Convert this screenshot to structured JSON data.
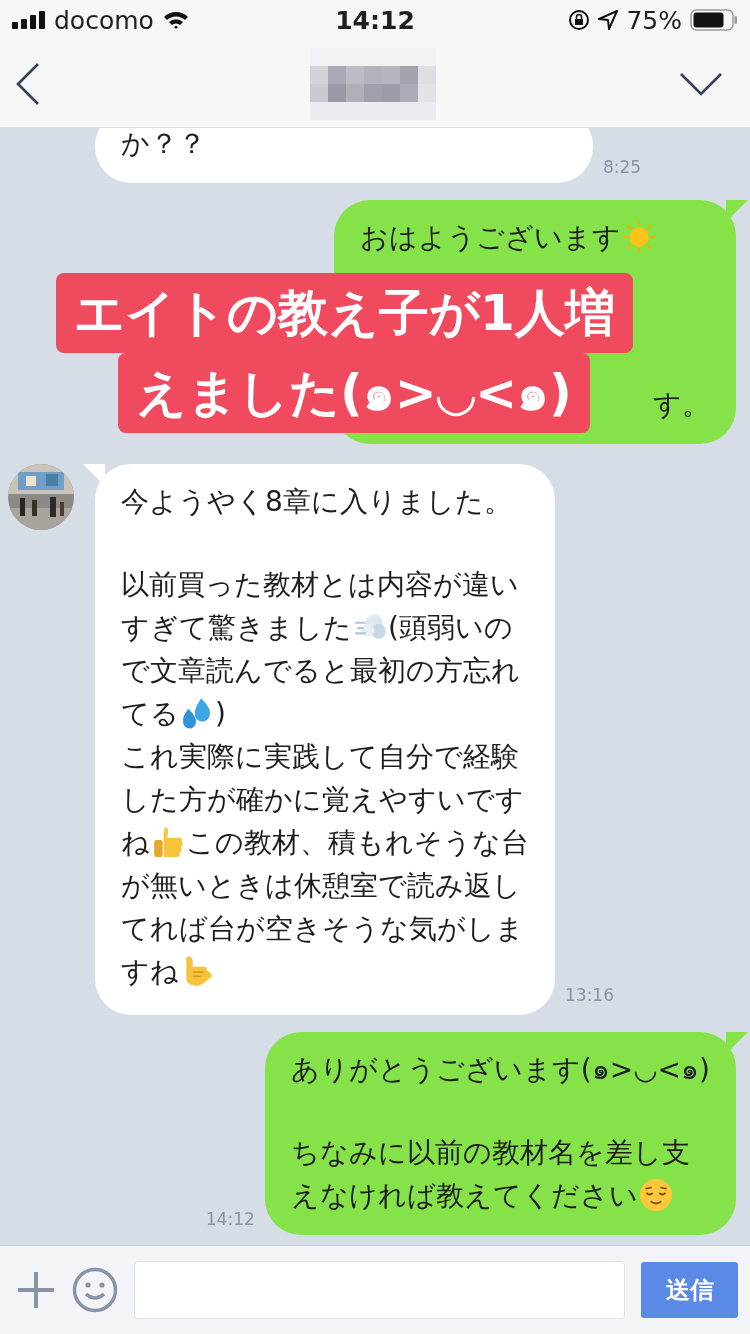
{
  "status_bar": {
    "carrier": "docomo",
    "time": "14:12",
    "battery": "75%"
  },
  "messages": [
    {
      "kind": "received",
      "avatar": false,
      "cut_top": true,
      "time": "8:25",
      "paragraphs": [
        [
          [
            {
              "kind": "text",
              "text": "か？？"
            }
          ]
        ]
      ]
    },
    {
      "kind": "sent",
      "covered": true,
      "paragraphs": [
        [
          [
            {
              "kind": "text",
              "text": "おはようございます"
            },
            {
              "kind": "sun"
            }
          ]
        ],
        [
          [
            {
              "kind": "text",
              "text": "す。"
            }
          ]
        ]
      ]
    },
    {
      "kind": "received",
      "avatar": true,
      "time": "13:16",
      "paragraphs": [
        [
          [
            {
              "kind": "text",
              "text": "今ようやく8章に入りました。"
            }
          ]
        ],
        [
          [
            {
              "kind": "text",
              "text": "以前買った教材とは内容が違い"
            }
          ],
          [
            {
              "kind": "text",
              "text": "すぎて驚きました"
            },
            {
              "kind": "dash"
            },
            {
              "kind": "text",
              "text": "(頭弱いの"
            }
          ],
          [
            {
              "kind": "text",
              "text": "で文章読んでると最初の方忘れ"
            }
          ],
          [
            {
              "kind": "text",
              "text": "てる"
            },
            {
              "kind": "sweat"
            },
            {
              "kind": "text",
              "text": ")"
            }
          ],
          [
            {
              "kind": "text",
              "text": "これ実際に実践して自分で経験"
            }
          ],
          [
            {
              "kind": "text",
              "text": "した方が確かに覚えやすいです"
            }
          ],
          [
            {
              "kind": "text",
              "text": "ね"
            },
            {
              "kind": "thumbs"
            },
            {
              "kind": "text",
              "text": "この教材、積もれそうな台"
            }
          ],
          [
            {
              "kind": "text",
              "text": "が無いときは休憩室で読み返し"
            }
          ],
          [
            {
              "kind": "text",
              "text": "てれば台が空きそうな気がしま"
            }
          ],
          [
            {
              "kind": "text",
              "text": "すね"
            },
            {
              "kind": "hand"
            }
          ]
        ]
      ]
    },
    {
      "kind": "sent",
      "time": "14:12",
      "paragraphs": [
        [
          [
            {
              "kind": "text",
              "text": "ありがとうございます(๑>◡<๑)"
            }
          ]
        ],
        [
          [
            {
              "kind": "text",
              "text": "ちなみに以前の教材名を差し支"
            }
          ],
          [
            {
              "kind": "text",
              "text": "えなければ教えてください"
            },
            {
              "kind": "relieved"
            }
          ]
        ]
      ]
    }
  ],
  "caption": [
    "エイトの教え子が1人増",
    "えました(๑>◡<๑)"
  ],
  "composer": {
    "send": "送信"
  }
}
